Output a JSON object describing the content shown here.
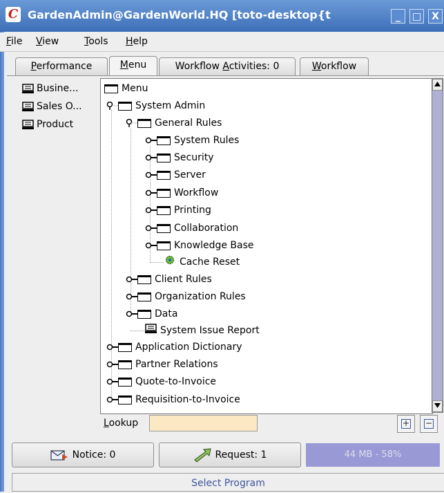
{
  "window": {
    "title": "GardenAdmin@GardenWorld.HQ [toto-desktop{t",
    "app_icon_glyph": "C",
    "btn_min": "_",
    "btn_max": "□",
    "btn_close": "X"
  },
  "menubar": {
    "file_m": "F",
    "file_r": "ile",
    "view_m": "V",
    "view_r": "iew",
    "tools_m": "T",
    "tools_r": "ools",
    "help_m": "H",
    "help_r": "elp"
  },
  "tabs": {
    "performance_m": "P",
    "performance_r": "erformance",
    "menu_m": "M",
    "menu_r": "enu",
    "workflow_activities_pre": "Workflow ",
    "workflow_activities_m": "A",
    "workflow_activities_r": "ctivities: 0",
    "workflow_m": "W",
    "workflow_r": "orkflow"
  },
  "sidebar": {
    "items": [
      "Busine...",
      "Sales O...",
      "Product"
    ]
  },
  "tree": {
    "root": "Menu",
    "system_admin": "System Admin",
    "general_rules": "General Rules",
    "system_rules": "System Rules",
    "security": "Security",
    "server": "Server",
    "workflow": "Workflow",
    "printing": "Printing",
    "collaboration": "Collaboration",
    "knowledge_base": "Knowledge Base",
    "cache_reset": "Cache Reset",
    "client_rules": "Client Rules",
    "organization_rules": "Organization Rules",
    "data": "Data",
    "system_issue_report": "System Issue Report",
    "application_dictionary": "Application Dictionary",
    "partner_relations": "Partner Relations",
    "quote_to_invoice": "Quote-to-Invoice",
    "requisition_to_invoice": "Requisition-to-Invoice"
  },
  "lookup": {
    "label_m": "L",
    "label_r": "ookup",
    "value": ""
  },
  "expand_glyph": "+",
  "collapse_glyph": "−",
  "bottom": {
    "notice": "Notice: 0",
    "request": "Request: 1",
    "memory": "44 MB - 58%",
    "memory_fraction": 0.58
  },
  "status": "Select Program",
  "colors": {
    "title_bar": "#3d6fb8",
    "memory_bar": "#9999d6",
    "lookup_bg": "#fde8c4",
    "status_text": "#3c55a0"
  }
}
